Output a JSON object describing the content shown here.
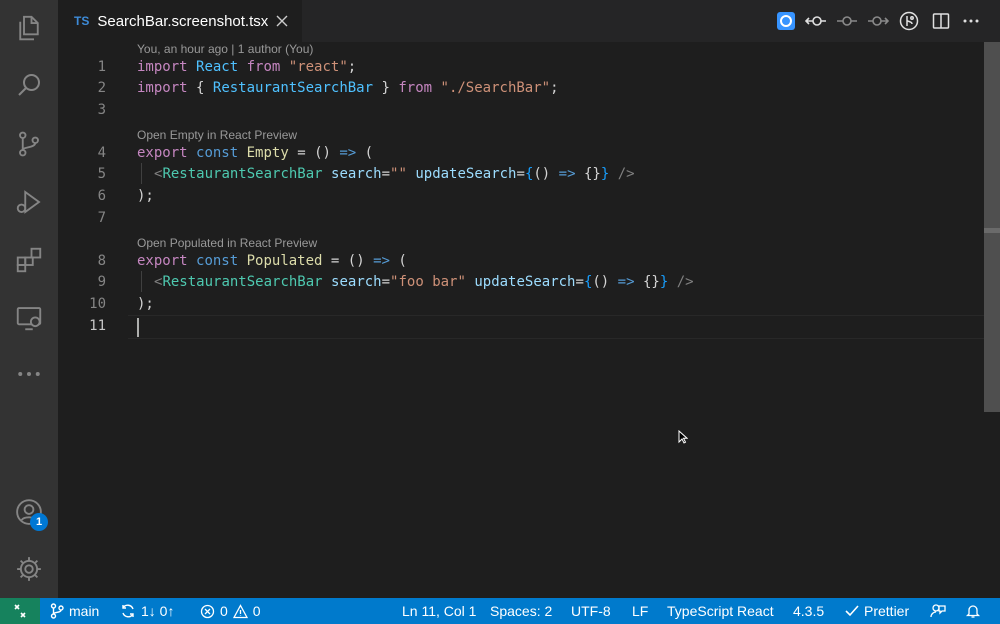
{
  "tab": {
    "lang": "TS",
    "title": "SearchBar.screenshot.tsx"
  },
  "editor": {
    "blame": "You, an hour ago | 1 author (You)",
    "codelens_empty": "Open Empty in React Preview",
    "codelens_populated": "Open Populated in React Preview",
    "line_numbers": [
      "1",
      "2",
      "3",
      "4",
      "5",
      "6",
      "7",
      "8",
      "9",
      "10",
      "11"
    ],
    "lines": {
      "l1": {
        "import": "import",
        "react": "React",
        "from": "from",
        "module": "\"react\"",
        "semi": ";"
      },
      "l2": {
        "import": "import",
        "open": "{",
        "name": "RestaurantSearchBar",
        "close": "}",
        "from": "from",
        "module": "\"./SearchBar\"",
        "semi": ";"
      },
      "l4": {
        "export": "export",
        "const": "const",
        "name": "Empty",
        "eq": "=",
        "parens": "()",
        "arrow": "=>",
        "open": "("
      },
      "l5": {
        "lt": "<",
        "tag": "RestaurantSearchBar",
        "attr1": "search",
        "eq1": "=",
        "val1": "\"\"",
        "attr2": "updateSearch",
        "eq2": "=",
        "b1": "{",
        "parens": "()",
        "arrow": "=>",
        "b2": "{}",
        "b3": "}",
        "end": "/>"
      },
      "l6": {
        "text": ");"
      },
      "l8": {
        "export": "export",
        "const": "const",
        "name": "Populated",
        "eq": "=",
        "parens": "()",
        "arrow": "=>",
        "open": "("
      },
      "l9": {
        "lt": "<",
        "tag": "RestaurantSearchBar",
        "attr1": "search",
        "eq1": "=",
        "val1": "\"foo bar\"",
        "attr2": "updateSearch",
        "eq2": "=",
        "b1": "{",
        "parens": "()",
        "arrow": "=>",
        "b2": "{}",
        "b3": "}",
        "end": "/>"
      },
      "l10": {
        "text": ");"
      }
    }
  },
  "activity": {
    "badge": "1"
  },
  "status": {
    "branch": "main",
    "sync": "1↓ 0↑",
    "errors": "0",
    "warnings": "0",
    "position": "Ln 11, Col 1",
    "spaces": "Spaces: 2",
    "encoding": "UTF-8",
    "eol": "LF",
    "language": "TypeScript React",
    "ts_version": "4.3.5",
    "prettier": "Prettier"
  },
  "icons": [
    "files-icon",
    "search-icon",
    "source-control-icon",
    "run-debug-icon",
    "extensions-icon",
    "remote-explorer-icon",
    "more-icon",
    "account-icon",
    "gear-icon",
    "preview-icon",
    "timeline-icon",
    "branch-icon",
    "split-icon",
    "close-icon",
    "bell-icon",
    "feedback-icon"
  ],
  "colors": {
    "statusbar": "#007acc",
    "remote": "#16825d",
    "activitybar": "#333333",
    "editor": "#1e1e1e"
  }
}
